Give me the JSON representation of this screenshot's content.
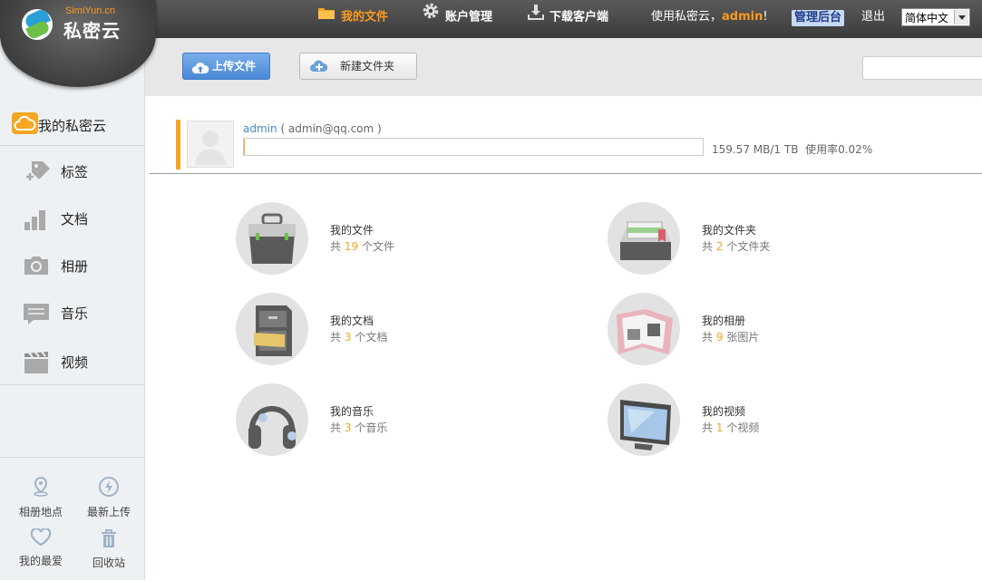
{
  "brand": {
    "en": "SimiYun.cn",
    "cn": "私密云"
  },
  "nav": [
    {
      "label": "我的文件",
      "icon": "folder-icon",
      "active": true
    },
    {
      "label": "账户管理",
      "icon": "gear-icon",
      "active": false
    },
    {
      "label": "下载客户端",
      "icon": "download-icon",
      "active": false
    }
  ],
  "header": {
    "welcome_prefix": "使用私密云，",
    "username": "admin",
    "welcome_suffix": "!",
    "admin_label": "管理后台",
    "logout_label": "退出",
    "language": "简体中文"
  },
  "toolbar": {
    "upload_label": "上传文件",
    "new_folder_label": "新建文件夹",
    "search_placeholder": ""
  },
  "sidebar": {
    "head": "我的私密云",
    "items": [
      {
        "label": "标签",
        "icon": "tag-icon"
      },
      {
        "label": "文档",
        "icon": "document-chart-icon"
      },
      {
        "label": "相册",
        "icon": "camera-icon"
      },
      {
        "label": "音乐",
        "icon": "message-icon"
      },
      {
        "label": "视频",
        "icon": "clapperboard-icon"
      }
    ],
    "bottom": [
      {
        "label": "相册地点",
        "icon": "location-pin-icon"
      },
      {
        "label": "最新上传",
        "icon": "lightning-icon"
      },
      {
        "label": "我的最爱",
        "icon": "heart-icon"
      },
      {
        "label": "回收站",
        "icon": "trash-icon"
      }
    ]
  },
  "profile": {
    "username": "admin",
    "email_text": "( admin@qq.com )",
    "used": "159.57 MB/1 TB",
    "usage_label": "使用率0.02%",
    "usage_fraction": 0.0002
  },
  "cards": [
    {
      "title": "我的文件",
      "prefix": "共",
      "count": "19",
      "suffix": "个文件",
      "icon": "briefcase-icon"
    },
    {
      "title": "我的文件夹",
      "prefix": "共",
      "count": "2",
      "suffix": "个文件夹",
      "icon": "file-tray-icon"
    },
    {
      "title": "我的文档",
      "prefix": "共",
      "count": "3",
      "suffix": "个文档",
      "icon": "file-cabinet-icon"
    },
    {
      "title": "我的相册",
      "prefix": "共",
      "count": "9",
      "suffix": "张图片",
      "icon": "photo-album-icon"
    },
    {
      "title": "我的音乐",
      "prefix": "共",
      "count": "3",
      "suffix": "个音乐",
      "icon": "headphones-icon"
    },
    {
      "title": "我的视频",
      "prefix": "共",
      "count": "1",
      "suffix": "个视频",
      "icon": "monitor-icon"
    }
  ],
  "colors": {
    "accent": "#f5a623",
    "link": "#4a88c8",
    "upload_button": "#4a88d6"
  }
}
